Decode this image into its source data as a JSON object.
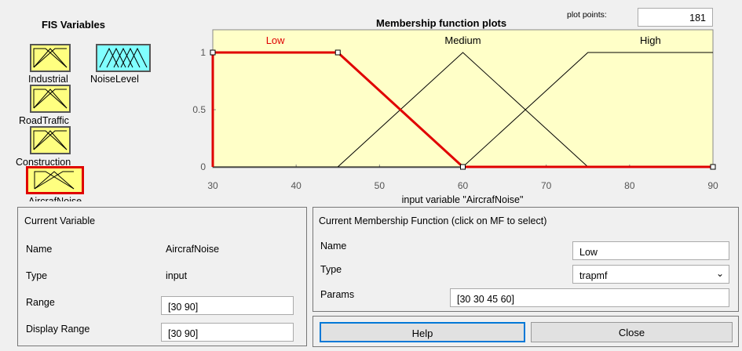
{
  "fis": {
    "title": "FIS Variables",
    "variables": [
      {
        "name": "Industrial"
      },
      {
        "name": "NoiseLevel"
      },
      {
        "name": "RoadTraffic"
      },
      {
        "name": "Construction"
      },
      {
        "name": "AircrafNoise"
      }
    ]
  },
  "plot": {
    "title": "Membership function plots",
    "plot_points_label": "plot points:",
    "plot_points_value": "181",
    "xlabel": "input variable \"AircrafNoise\"",
    "x_ticks": [
      "30",
      "40",
      "50",
      "60",
      "70",
      "80",
      "90"
    ],
    "y_ticks": [
      "1",
      "0.5",
      "0"
    ],
    "mf_labels": [
      "Low",
      "Medium",
      "High"
    ],
    "colors": {
      "background": "#ffffc8",
      "selected": "#e00000",
      "line": "#000000"
    }
  },
  "chart_data": {
    "type": "line",
    "xlabel": "input variable \"AircrafNoise\"",
    "ylabel": "",
    "xlim": [
      30,
      90
    ],
    "ylim": [
      0,
      1
    ],
    "series": [
      {
        "name": "Low",
        "x": [
          30,
          30,
          45,
          60,
          90
        ],
        "y": [
          0,
          1,
          1,
          0,
          0
        ],
        "selected": true
      },
      {
        "name": "Medium",
        "x": [
          30,
          45,
          60,
          75,
          90
        ],
        "y": [
          0,
          0,
          1,
          0,
          0
        ]
      },
      {
        "name": "High",
        "x": [
          30,
          60,
          75,
          90
        ],
        "y": [
          0,
          0,
          1,
          1
        ]
      }
    ]
  },
  "current_variable": {
    "header": "Current Variable",
    "name_label": "Name",
    "name_value": "AircrafNoise",
    "type_label": "Type",
    "type_value": "input",
    "range_label": "Range",
    "range_value": "[30 90]",
    "display_range_label": "Display Range",
    "display_range_value": "[30 90]"
  },
  "current_mf": {
    "header": "Current Membership Function (click on MF to select)",
    "name_label": "Name",
    "name_value": "Low",
    "type_label": "Type",
    "type_value": "trapmf",
    "params_label": "Params",
    "params_value": "[30 30 45 60]"
  },
  "buttons": {
    "help": "Help",
    "close": "Close"
  }
}
